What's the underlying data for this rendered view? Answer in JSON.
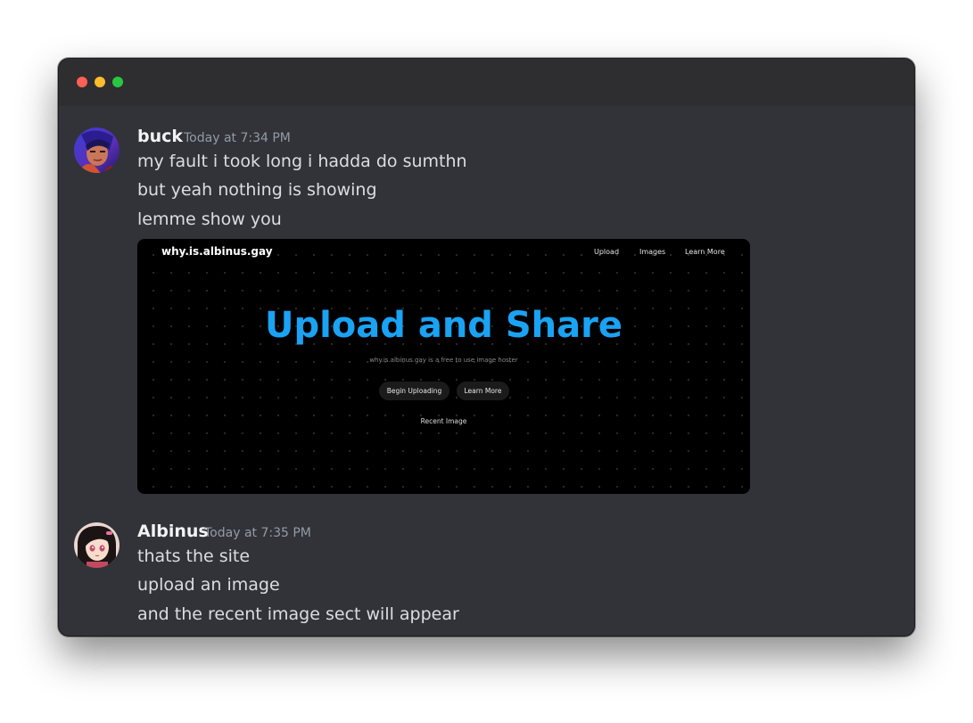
{
  "window": {
    "controls": [
      "close",
      "minimize",
      "zoom"
    ]
  },
  "messages": [
    {
      "author": "buck",
      "timestamp": "Today at 7:34 PM",
      "lines": [
        "my fault i took long i hadda do sumthn",
        "but yeah nothing is showing",
        "lemme show you"
      ],
      "embed": {
        "site_logo": "why.is.albinus.gay",
        "nav": [
          "Upload",
          "Images",
          "Learn More"
        ],
        "hero_title": "Upload and Share",
        "hero_subtitle": "why.is.albinus.gay is a free to use image hoster",
        "buttons": [
          "Begin Uploading",
          "Learn More"
        ],
        "recent_label": "Recent Image"
      }
    },
    {
      "author": "Albinus",
      "timestamp": "Today at 7:35 PM",
      "lines": [
        "thats the site",
        "upload an image",
        "and the recent image sect will appear"
      ]
    }
  ],
  "colors": {
    "background": "#313338",
    "titlebar": "#2e2e30",
    "accent_blue": "#1aa3f3",
    "close": "#fe5f57",
    "minimize": "#febc2e",
    "zoom": "#28c840"
  }
}
